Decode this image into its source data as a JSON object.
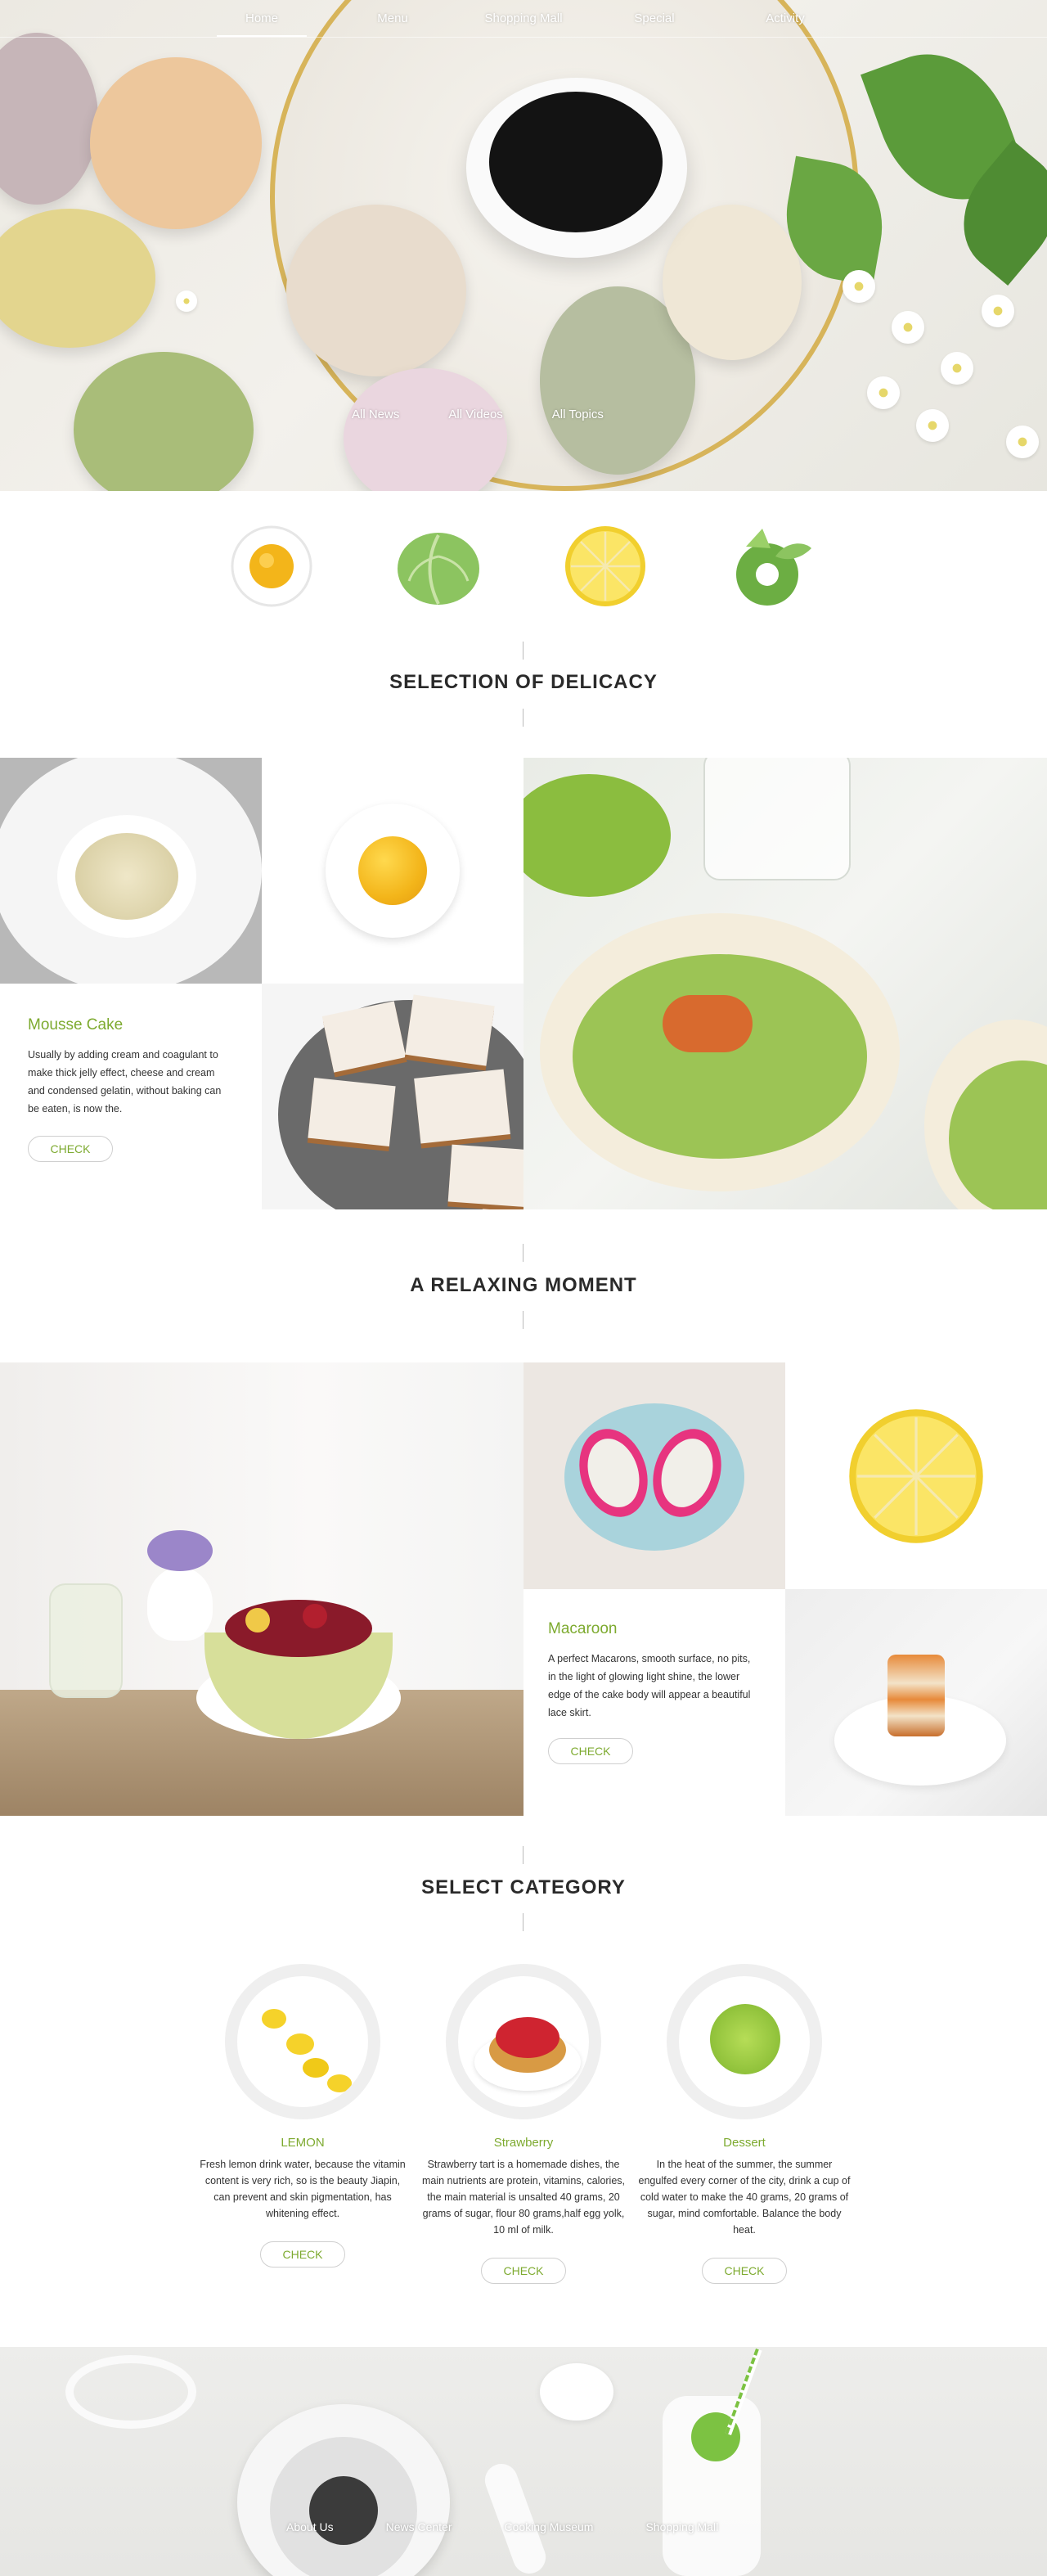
{
  "nav": {
    "items": [
      "Home",
      "Menu",
      "Shopping Mall",
      "Special",
      "Activity"
    ]
  },
  "hero": {
    "links": [
      "All News",
      "All Videos",
      "All  Topics"
    ]
  },
  "icons": [
    "egg-icon",
    "cabbage-icon",
    "lemon-slice-icon",
    "lime-icon"
  ],
  "section1": {
    "title": "SELECTION OF DELICACY"
  },
  "mousse": {
    "title": "Mousse Cake",
    "text": "Usually by adding cream and coagulant to make thick jelly effect, cheese and cream and condensed gelatin, without baking can be eaten, is now the.",
    "button": "CHECK"
  },
  "section2": {
    "title": "A RELAXING MOMENT"
  },
  "macaroon": {
    "title": "Macaroon",
    "text": "A perfect Macarons, smooth surface, no pits, in the light of glowing light shine, the lower edge of the cake body will appear a beautiful lace skirt.",
    "button": "CHECK"
  },
  "section3": {
    "title": "SELECT CATEGORY"
  },
  "categories": [
    {
      "name": "LEMON",
      "desc": "Fresh lemon drink water, because the vitamin content is very rich, so is the beauty Jiapin, can prevent and  skin pigmentation, has whitening effect.",
      "button": "CHECK"
    },
    {
      "name": "Strawberry",
      "desc": "Strawberry tart is a homemade dishes, the main nutrients are protein, vitamins, calories, the main material is unsalted 40 grams, 20 grams of sugar, flour 80 grams,half egg yolk, 10 ml of milk.",
      "button": "CHECK"
    },
    {
      "name": "Dessert",
      "desc": "In the heat of the summer, the summer engulfed every corner of the city, drink a cup of cold water to make the 40 grams, 20 grams of sugar, mind comfortable. Balance the body heat.",
      "button": "CHECK"
    }
  ],
  "footer": {
    "links": [
      "About Us",
      "News Center",
      "Cooking Museum",
      "Shopping Mall"
    ]
  },
  "colors": {
    "accent": "#7daa2f",
    "gold": "#d7b45a",
    "yolk": "#f3b51a"
  }
}
